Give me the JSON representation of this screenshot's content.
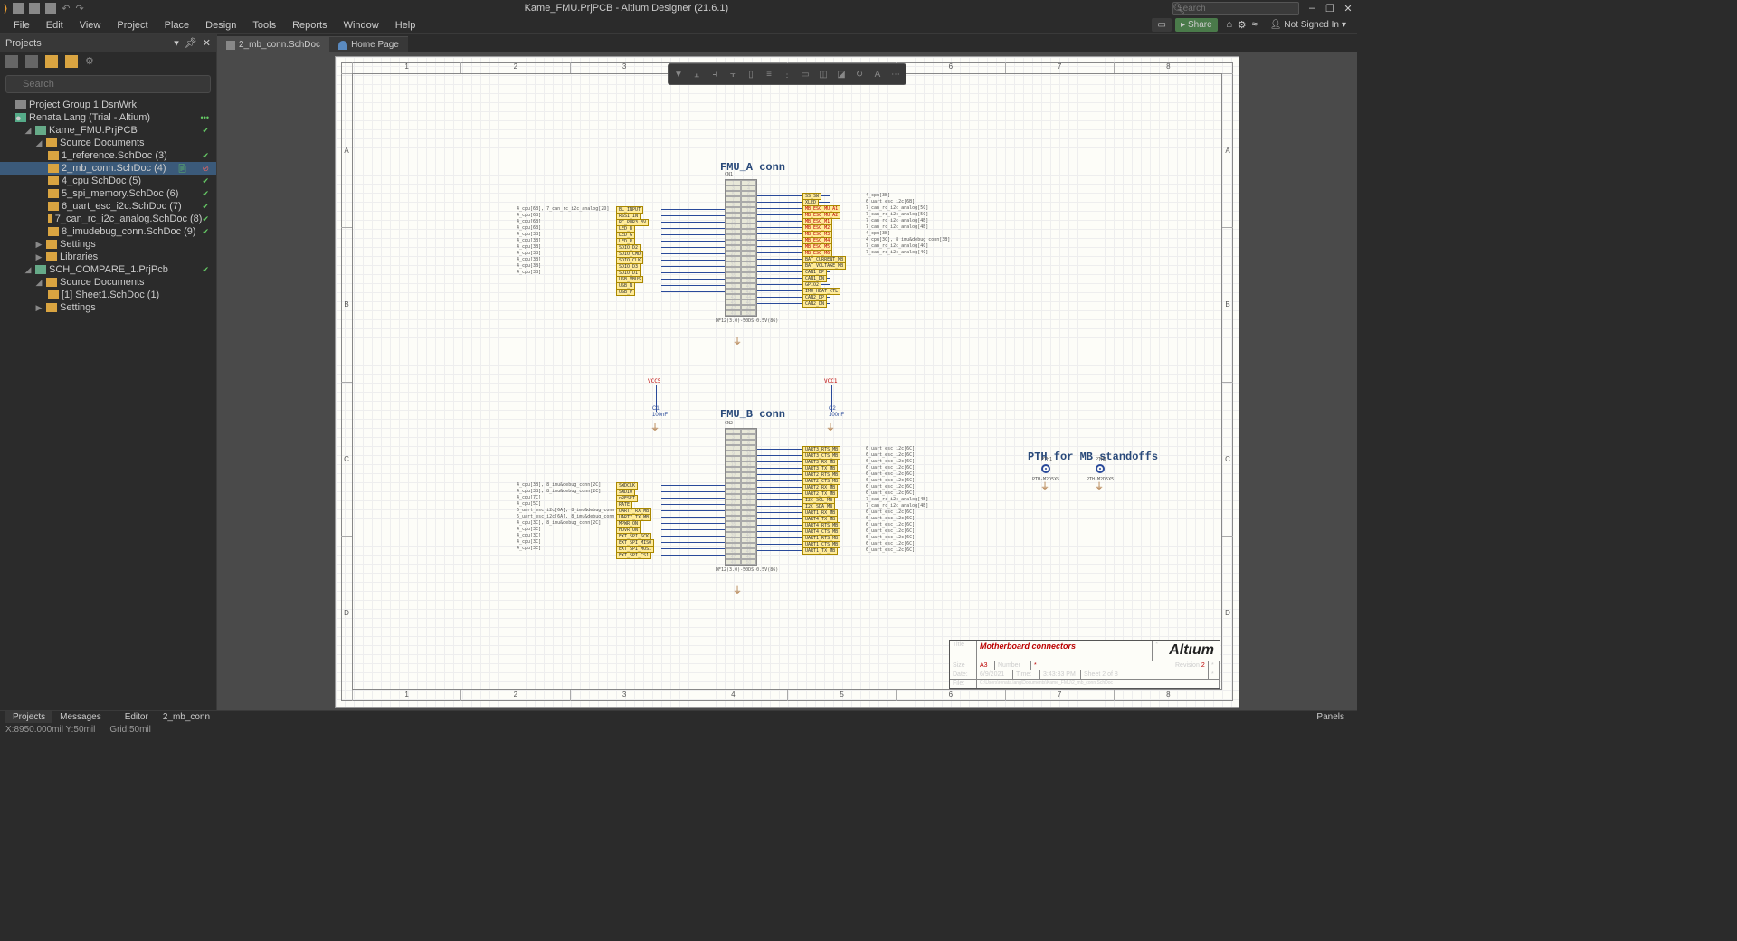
{
  "title": "Kame_FMU.PrjPCB - Altium Designer (21.6.1)",
  "search_placeholder": "Search",
  "menus": [
    "File",
    "Edit",
    "View",
    "Project",
    "Place",
    "Design",
    "Tools",
    "Reports",
    "Window",
    "Help"
  ],
  "share_label": "Share",
  "signin_label": "Not Signed In",
  "panel_title": "Projects",
  "proj_search_placeholder": "Search",
  "tree": {
    "group": "Project Group 1.DsnWrk",
    "user": "Renata Lang (Trial - Altium)",
    "proj1": "Kame_FMU.PrjPCB",
    "src1": "Source Documents",
    "docs1": [
      "1_reference.SchDoc (3)",
      "2_mb_conn.SchDoc (4)",
      "4_cpu.SchDoc (5)",
      "5_spi_memory.SchDoc (6)",
      "6_uart_esc_i2c.SchDoc (7)",
      "7_can_rc_i2c_analog.SchDoc (8)",
      "8_imudebug_conn.SchDoc (9)"
    ],
    "settings": "Settings",
    "libraries": "Libraries",
    "proj2": "SCH_COMPARE_1.PrjPcb",
    "src2": "Source Documents",
    "docs2": [
      "[1] Sheet1.SchDoc (1)"
    ]
  },
  "tabs": {
    "doc": "2_mb_conn.SchDoc",
    "home": "Home Page"
  },
  "schematic": {
    "title_a": "FMU_A conn",
    "title_b": "FMU_B conn",
    "title_pth": "PTH for MB standoffs",
    "cn1": "CN1",
    "cn2": "CN2",
    "footprint": "DF12(3.0)-50DS-0.5V(86)",
    "vcc5": "VCC5",
    "vcc1": "VCC1",
    "c1": "C1",
    "c2": "C2",
    "cap_val": "100nF",
    "pth1": "PTH1",
    "pth2": "PTH2",
    "pth_fp": "PTH-M2D5X5",
    "nets_a_left": [
      "BL_INPUT",
      "RSSI_IN",
      "RC_PWR3.3V",
      "LED_B",
      "LED_G",
      "LED_R",
      "SDIO_D2",
      "SDIO_CMD",
      "SDIO_CLK",
      "SDIO_D3",
      "SDIO_D1",
      "USB_VBUS",
      "USB_N",
      "USB_P"
    ],
    "nets_a_right": [
      "SS_SW",
      "XLED",
      "MB_ESC_MU_A1",
      "MB_ESC_MU_A2",
      "MB_ESC_M1",
      "MB_ESC_M2",
      "MB_ESC_M3",
      "MB_ESC_M4",
      "MB_ESC_M5",
      "MB_ESC_M6",
      "BAT_CURRENT_MB",
      "BAT_VOLTAGE_MB",
      "CAN1_DP",
      "CAN1_DN",
      "GPIO2",
      "IMU_HEAT_CTL",
      "CAN2_DP",
      "CAN2_DN"
    ],
    "refs_a_left": [
      "4_cpu[6B], 7_can_rc_i2c_analog[2D]",
      "4_cpu[6B]",
      "4_cpu[6B]",
      "4_cpu[6B]",
      "4_cpu[3B]",
      "4_cpu[3B]",
      "4_cpu[3B]",
      "4_cpu[3B]",
      "4_cpu[3B]",
      "4_cpu[3B]",
      "4_cpu[3B]"
    ],
    "refs_a_right": [
      "4_cpu[3B]",
      "6_uart_esc_i2c[6B]",
      "7_can_rc_i2c_analog[5C]",
      "7_can_rc_i2c_analog[5C]",
      "7_can_rc_i2c_analog[4B]",
      "7_can_rc_i2c_analog[4B]",
      "4_cpu[3B]",
      "4_cpu[3C], 8_imu&debug_conn[3B]",
      "7_can_rc_i2c_analog[4C]",
      "7_can_rc_i2c_analog[4C]"
    ],
    "nets_b_left": [
      "SWDCLK",
      "SWDIO",
      "nRESET",
      "RATE",
      "UART7_RX_MB",
      "UART7_TX_MB",
      "MPWR_ON",
      "HOVR_ON",
      "EXT_SPI_SCK",
      "EXT_SPI_MISO",
      "EXT_SPI_MOSI",
      "EXT_SPI_CS1"
    ],
    "nets_b_right": [
      "UART3_RTS_MB",
      "UART3_CTS_MB",
      "UART3_RX_MB",
      "UART3_TX_MB",
      "UART2_RTS_MB",
      "UART2_CTS_MB",
      "UART2_RX_MB",
      "UART2_TX_MB",
      "I2C_SCL_MB",
      "I2C_SDA_MB",
      "UART1_RX_MB",
      "UART4_TX_MB",
      "UART4_RTS_MB",
      "UART4_CTS_MB",
      "UART1_RTS_MB",
      "UART1_CTS_MB",
      "UART1_TX_MB"
    ],
    "refs_b_left": [
      "4_cpu[3B], 8_imu&debug_conn[2C]",
      "4_cpu[3B], 8_imu&debug_conn[2C]",
      "4_cpu[7C]",
      "4_cpu[5C]",
      "6_uart_esc_i2c[6A], 8_imu&debug_conn",
      "6_uart_esc_i2c[6A], 8_imu&debug_conn",
      "4_cpu[3C], 8_imu&debug_conn[2C]",
      "4_cpu[3C]",
      "4_cpu[3C]",
      "4_cpu[3C]",
      "4_cpu[3C]"
    ],
    "refs_b_right": [
      "6_uart_esc_i2c[6C]",
      "6_uart_esc_i2c[6C]",
      "6_uart_esc_i2c[6C]",
      "6_uart_esc_i2c[6C]",
      "6_uart_esc_i2c[6C]",
      "6_uart_esc_i2c[6C]",
      "6_uart_esc_i2c[6C]",
      "6_uart_esc_i2c[6C]",
      "7_can_rc_i2c_analog[4B]",
      "7_can_rc_i2c_analog[4B]",
      "6_uart_esc_i2c[6C]",
      "6_uart_esc_i2c[6C]",
      "6_uart_esc_i2c[6C]",
      "6_uart_esc_i2c[6C]",
      "6_uart_esc_i2c[6C]",
      "6_uart_esc_i2c[6C]",
      "6_uart_esc_i2c[6C]"
    ],
    "ruler_h": [
      "1",
      "2",
      "3",
      "4",
      "5",
      "6",
      "7",
      "8"
    ],
    "ruler_v": [
      "A",
      "B",
      "C",
      "D"
    ]
  },
  "titleblock": {
    "title_label": "Title",
    "title": "Motherboard connectors",
    "size_label": "Size",
    "size": "A3",
    "number_label": "Number",
    "number": "*",
    "revision_label": "Revision",
    "revision": "2",
    "date_label": "Date:",
    "date": "6/9/2021",
    "time_label": "Time:",
    "time": "3:43:33 PM",
    "sheet_label": "Sheet 2   of   8",
    "file_label": "File:",
    "file": "C:\\Users\\renata.lang\\Documents\\Kame_FMU\\2_mb_conn.SchDoc",
    "logo": "Altıum"
  },
  "bottom": {
    "tab1": "Projects",
    "tab2": "Messages",
    "editor": "Editor",
    "docname": "2_mb_conn",
    "panels": "Panels"
  },
  "status": {
    "xy": "X:8950.000mil Y:50mil",
    "grid": "Grid:50mil"
  }
}
